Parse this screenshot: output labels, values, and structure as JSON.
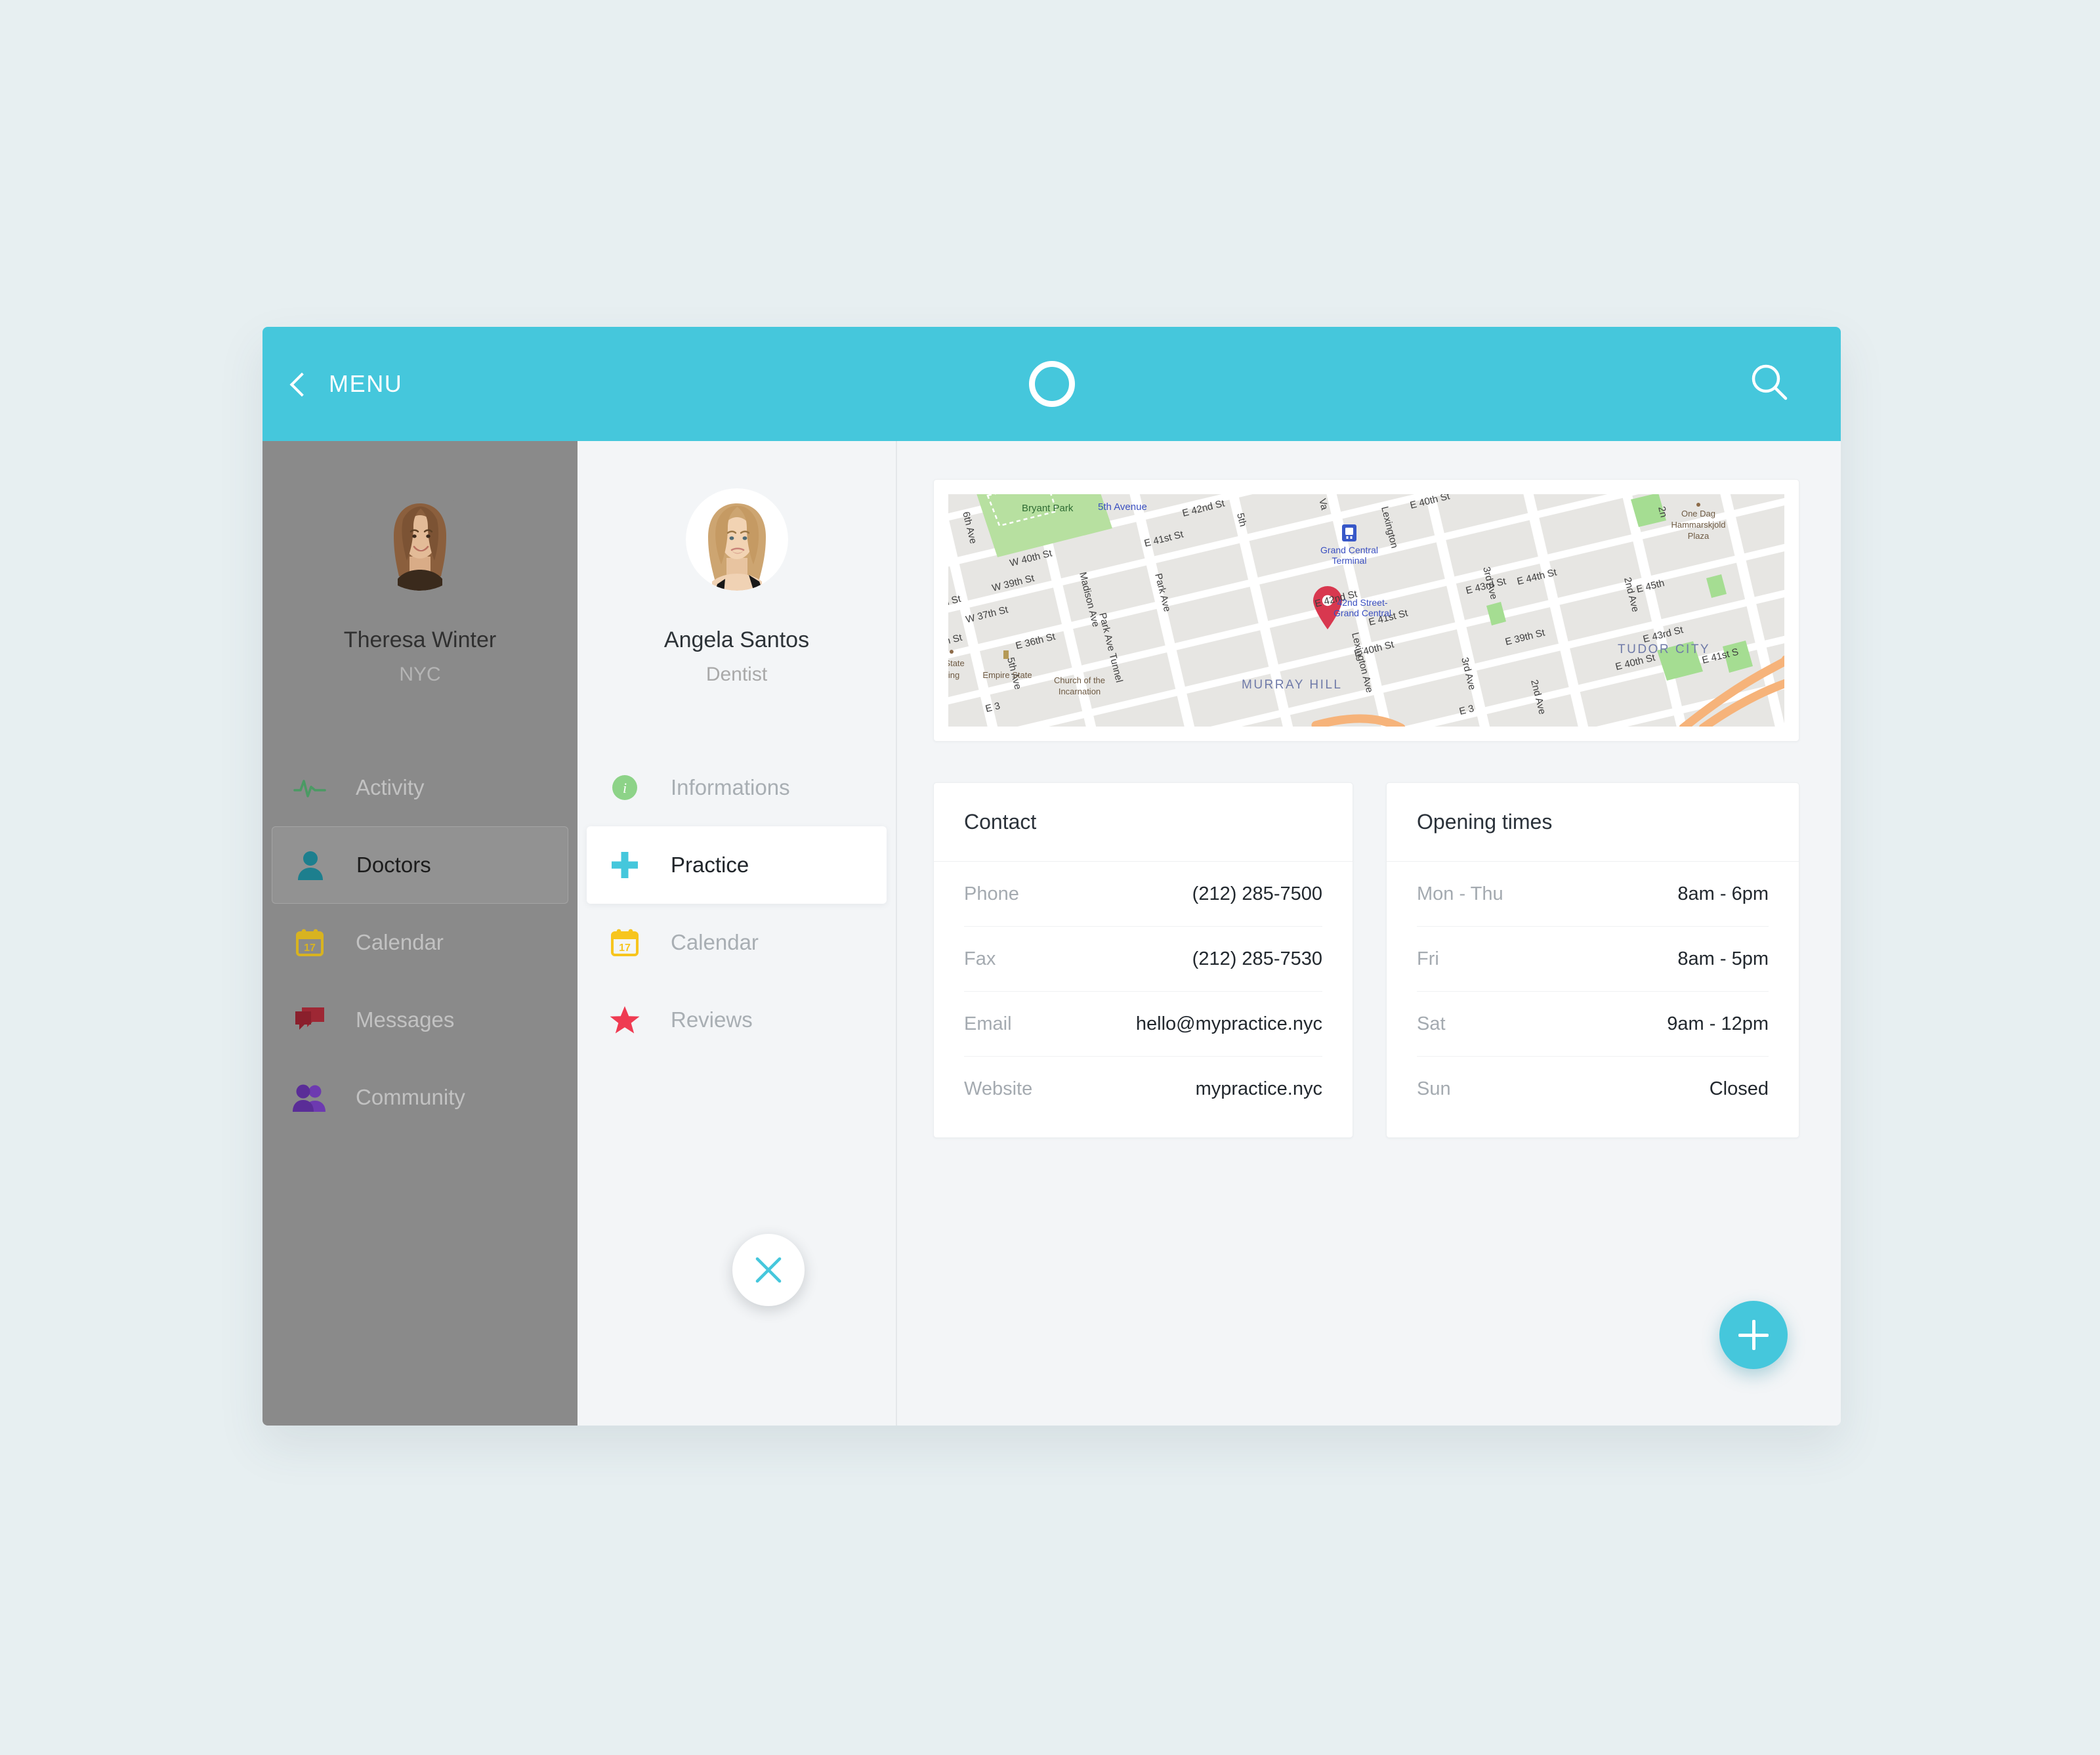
{
  "topbar": {
    "back_icon": "chevron-left-icon",
    "menu_label": "MENU",
    "logo_icon": "circle-logo",
    "search_icon": "search-icon",
    "accent_color": "#45c7dc"
  },
  "sidebar": {
    "background_color": "#8a8a8a",
    "profile": {
      "name": "Theresa Winter",
      "location": "NYC",
      "avatar_icon": "avatar-theresa-winter"
    },
    "items": [
      {
        "label": "Activity",
        "icon": "pulse-icon",
        "color": "#4b9a64",
        "active": false
      },
      {
        "label": "Doctors",
        "icon": "person-icon",
        "color": "#1d7f8e",
        "active": true
      },
      {
        "label": "Calendar",
        "icon": "calendar-icon",
        "color": "#d8b320",
        "active": false
      },
      {
        "label": "Messages",
        "icon": "messages-icon",
        "color": "#9e2734",
        "active": false
      },
      {
        "label": "Community",
        "icon": "community-icon",
        "color": "#6d3ab0",
        "active": false
      }
    ],
    "close_button": {
      "icon": "close-icon",
      "color": "#45c7dc"
    }
  },
  "detail_panel": {
    "profile": {
      "name": "Angela Santos",
      "role": "Dentist",
      "avatar_icon": "avatar-angela-santos"
    },
    "items": [
      {
        "label": "Informations",
        "icon": "info-circle-icon",
        "color": "#8dd388",
        "active": false
      },
      {
        "label": "Practice",
        "icon": "medical-cross-icon",
        "color": "#45c7dc",
        "active": true
      },
      {
        "label": "Calendar",
        "icon": "calendar-icon",
        "color": "#f7c51e",
        "active": false
      },
      {
        "label": "Reviews",
        "icon": "star-icon",
        "color": "#ef3b52",
        "active": false
      }
    ]
  },
  "content": {
    "map": {
      "marker_icon": "map-pin-icon",
      "marker_color": "#d8384f",
      "neighborhood_labels": [
        "MURRAY HILL",
        "TUDOR CITY"
      ],
      "place_labels": [
        "Bryant Park",
        "5th Avenue",
        "Grand Central Terminal",
        "42nd Street-Grand Central",
        "One Dag Hammarskjold Plaza",
        "Empire State",
        "Empire State Building",
        "Church of the Incarnation"
      ],
      "street_labels": [
        "6th Ave",
        "5th Ave",
        "Madison Ave",
        "Park Ave",
        "Lexington Ave",
        "3rd Ave",
        "2nd Ave",
        "Park Ave Tunnel",
        "W 40th St",
        "W 39th St",
        "W 37th St",
        "E 36th St",
        "E 39th St",
        "E 40th St",
        "E 41st St",
        "E 42nd St",
        "E 43rd St",
        "E 44th St",
        "E 45th St"
      ]
    },
    "contact_card": {
      "title": "Contact",
      "rows": [
        {
          "label": "Phone",
          "value": "(212) 285-7500"
        },
        {
          "label": "Fax",
          "value": "(212) 285-7530"
        },
        {
          "label": "Email",
          "value": "hello@mypractice.nyc"
        },
        {
          "label": "Website",
          "value": "mypractice.nyc"
        }
      ]
    },
    "hours_card": {
      "title": "Opening times",
      "rows": [
        {
          "label": "Mon - Thu",
          "value": "8am - 6pm"
        },
        {
          "label": "Fri",
          "value": "8am - 5pm"
        },
        {
          "label": "Sat",
          "value": "9am - 12pm"
        },
        {
          "label": "Sun",
          "value": "Closed"
        }
      ]
    },
    "fab": {
      "icon": "plus-icon",
      "color": "#45c7dc"
    }
  }
}
